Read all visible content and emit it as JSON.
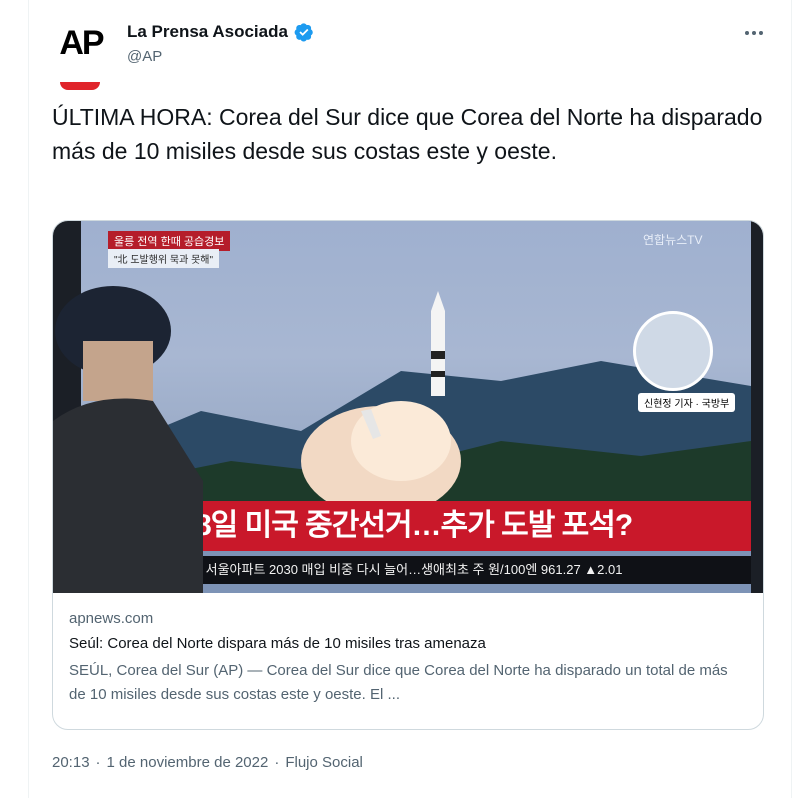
{
  "author": {
    "display_name": "La Prensa Asociada",
    "handle": "@AP",
    "avatar_text": "AP",
    "verified": true
  },
  "tweet": {
    "text": "ÚLTIMA HORA: Corea del Sur dice que Corea del Norte ha disparado más de 10 misiles desde sus costas este y oeste."
  },
  "link_card": {
    "domain": "apnews.com",
    "title": "Seúl: Corea del Norte dispara más de 10 misiles tras amenaza",
    "description": "SEÚL, Corea del Sur (AP) — Corea del Sur dice que Corea del Norte ha disparado un total de más de 10 misiles desde sus costas este y oeste. El ...",
    "media": {
      "tv_logo": "연합뉴스TV",
      "red_tag": "울릉 전역 한때 공습경보",
      "white_tag": "\"北 도발행위 묵과 못해\"",
      "headline": "8일 미국 중간선거…추가 도발 포석?",
      "ticker": "→ 서울아파트 2030 매입 비중 다시 늘어…생애최초 주  원/100엔  961.27  ▲2.01",
      "reporter_label": "신현정 기자 · 국방부"
    }
  },
  "footer": {
    "time": "20:13",
    "separator": "·",
    "date": "1 de noviembre de 2022",
    "source": "Flujo Social"
  },
  "colors": {
    "verified_blue": "#1d9bf0",
    "text_primary": "#0f1419",
    "text_secondary": "#536471",
    "border": "#cfd9de",
    "ap_red": "#e0242a"
  }
}
